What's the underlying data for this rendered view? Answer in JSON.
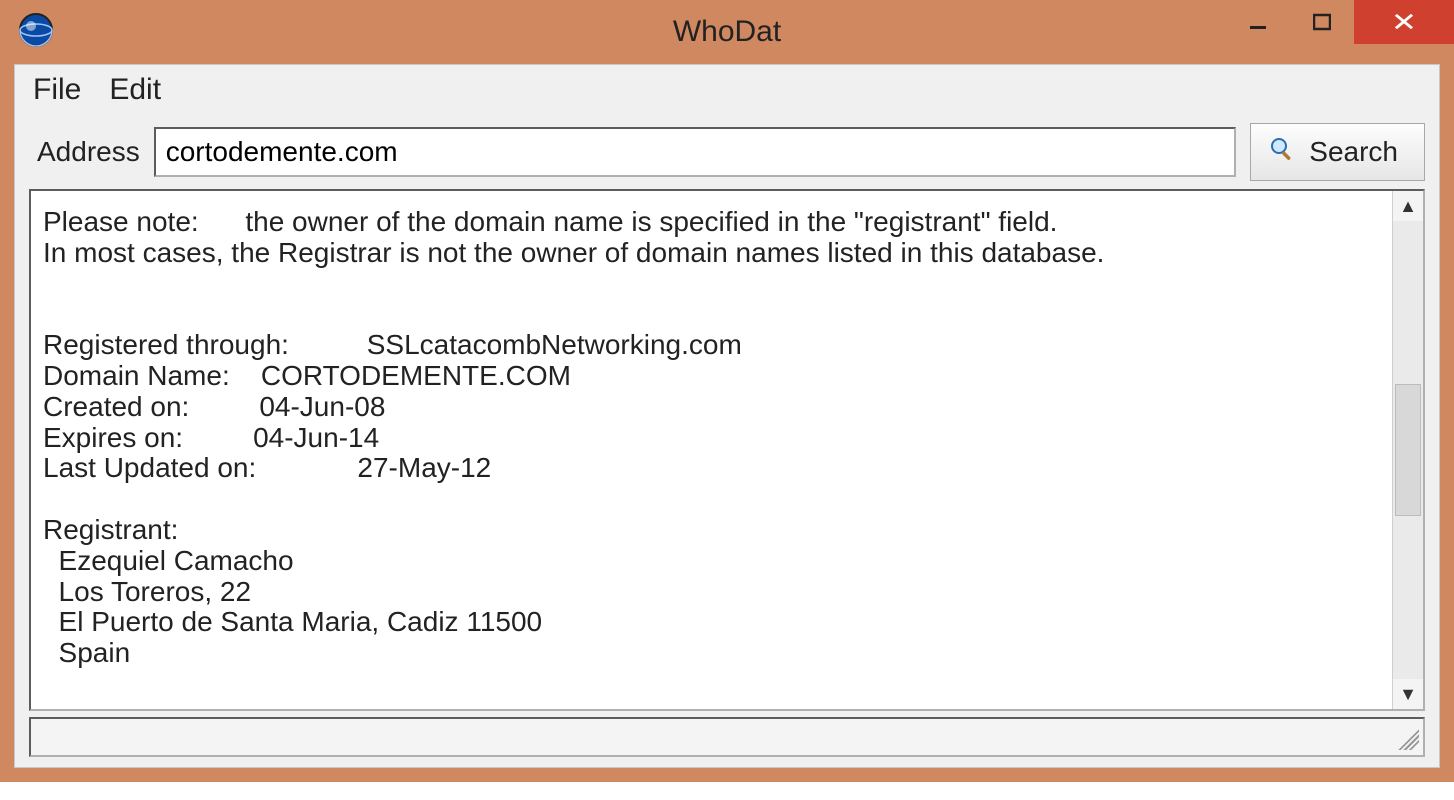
{
  "window": {
    "title": "WhoDat"
  },
  "menu": {
    "file": "File",
    "edit": "Edit"
  },
  "address": {
    "label": "Address",
    "value": "cortodemente.com",
    "search_label": "Search"
  },
  "results": {
    "note_line1": "Please note:      the owner of the domain name is specified in the \"registrant\" field.",
    "note_line2": "In most cases, the Registrar is not the owner of domain names listed in this database.",
    "registered_through_label": "Registered through:",
    "registered_through_value": "SSLcatacombNetworking.com",
    "domain_name_label": "Domain Name:",
    "domain_name_value": "CORTODEMENTE.COM",
    "created_label": "Created on:",
    "created_value": "04-Jun-08",
    "expires_label": "Expires on:",
    "expires_value": "04-Jun-14",
    "updated_label": "Last Updated on:",
    "updated_value": "27-May-12",
    "registrant_label": "Registrant:",
    "registrant_name": "Ezequiel Camacho",
    "registrant_street": "Los Toreros, 22",
    "registrant_city": "El Puerto de Santa Maria, Cadiz 11500",
    "registrant_country": "Spain"
  }
}
